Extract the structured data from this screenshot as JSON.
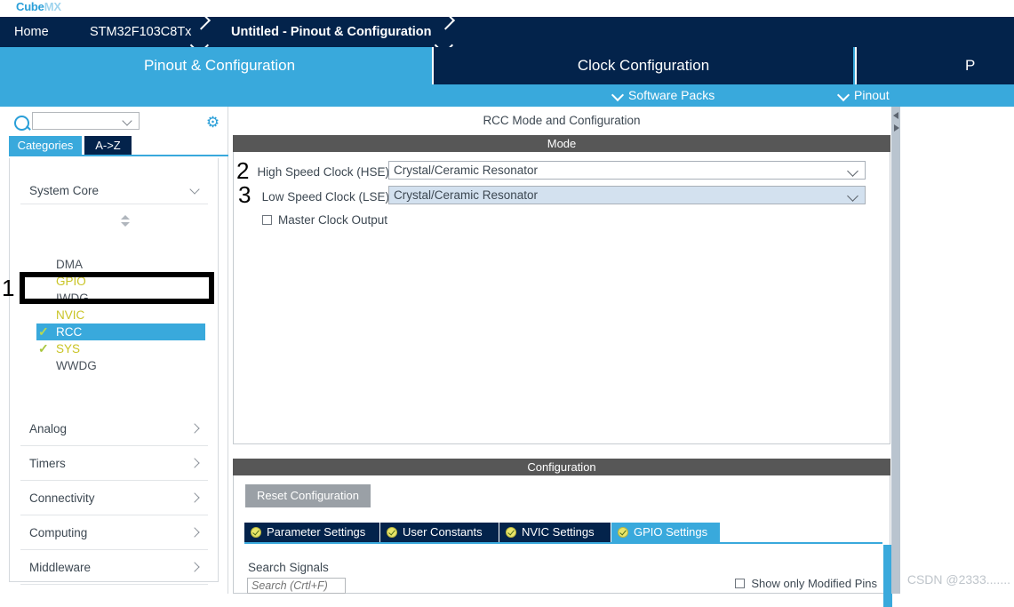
{
  "app": {
    "brand_cube": "Cube",
    "brand_mx": "MX"
  },
  "breadcrumb": {
    "items": [
      {
        "label": "Home"
      },
      {
        "label": "STM32F103C8Tx"
      },
      {
        "label": "Untitled - Pinout & Configuration"
      }
    ]
  },
  "main_tabs": [
    {
      "label": "Pinout & Configuration",
      "active": true
    },
    {
      "label": "Clock Configuration",
      "active": false
    },
    {
      "label": "P",
      "active": false
    }
  ],
  "sub_toolbar": {
    "software_packs": "Software Packs",
    "pinout": "Pinout"
  },
  "sidebar": {
    "search_value": "",
    "gear_icon": "gear-icon",
    "tabs": [
      {
        "label": "Categories",
        "selected": true
      },
      {
        "label": "A->Z",
        "selected": false
      }
    ],
    "system_core": {
      "label": "System Core",
      "items": [
        {
          "label": "DMA",
          "state": "normal",
          "checked": false
        },
        {
          "label": "GPIO",
          "state": "used",
          "checked": false
        },
        {
          "label": "IWDG",
          "state": "normal",
          "checked": false
        },
        {
          "label": "NVIC",
          "state": "used",
          "checked": false
        },
        {
          "label": "RCC",
          "state": "selected",
          "checked": true
        },
        {
          "label": "SYS",
          "state": "used",
          "checked": true
        },
        {
          "label": "WWDG",
          "state": "normal",
          "checked": false
        }
      ]
    },
    "categories": [
      {
        "label": "Analog"
      },
      {
        "label": "Timers"
      },
      {
        "label": "Connectivity"
      },
      {
        "label": "Computing"
      },
      {
        "label": "Middleware"
      }
    ]
  },
  "main": {
    "panel_title": "RCC Mode and Configuration",
    "mode_band": "Mode",
    "config_band": "Configuration",
    "mode": {
      "hse_label": "High Speed Clock (HSE)",
      "hse_value": "Crystal/Ceramic Resonator",
      "lse_label": "Low Speed Clock (LSE)",
      "lse_value": "Crystal/Ceramic Resonator",
      "mco_label": "Master Clock Output",
      "mco_checked": false
    },
    "configuration": {
      "reset_button": "Reset Configuration",
      "tabs": [
        {
          "label": "Parameter Settings",
          "active": false
        },
        {
          "label": "User Constants",
          "active": false
        },
        {
          "label": "NVIC Settings",
          "active": false
        },
        {
          "label": "GPIO Settings",
          "active": true
        }
      ],
      "search_signals_label": "Search Signals",
      "search_signals_placeholder": "Search (Crtl+F)",
      "search_signals_value": "",
      "show_modified_pins_label": "Show only Modified Pins",
      "show_modified_pins_checked": false
    }
  },
  "annotations": [
    {
      "number": "1"
    },
    {
      "number": "2"
    },
    {
      "number": "3"
    }
  ],
  "watermark": "CSDN @2333.......",
  "colors": {
    "brand_blue": "#39a9dc",
    "navy": "#03234b",
    "band_gray": "#575757",
    "selected_row": "#39a9dc",
    "used_peripheral": "#c9c425",
    "lse_highlight": "#d3e1ef"
  }
}
